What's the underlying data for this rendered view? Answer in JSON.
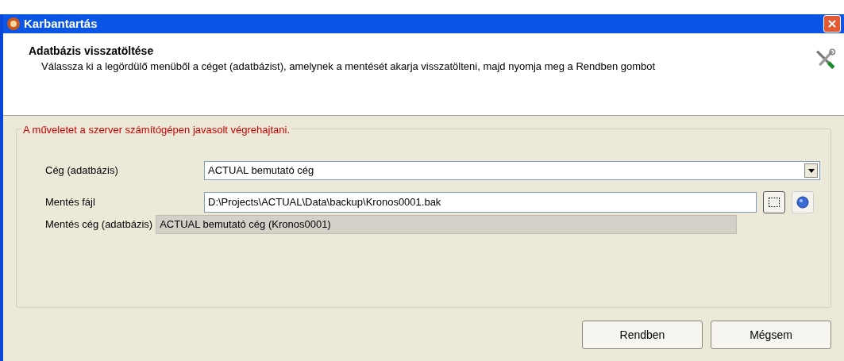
{
  "window": {
    "title": "Karbantartás"
  },
  "header": {
    "title": "Adatbázis visszatöltése",
    "description": "Válassza ki a legördülő menüből a céget (adatbázist), amelynek a mentését akarja visszatölteni, majd nyomja meg a Rendben gombot"
  },
  "group": {
    "title": "A műveletet a szerver számítógépen javasolt végrehajtani."
  },
  "fields": [
    {
      "kind": "dropdown",
      "label": "Cég (adatbázis)",
      "value": "ACTUAL bemutató cég"
    },
    {
      "kind": "file",
      "label": "Mentés fájl",
      "value": "D:\\Projects\\ACTUAL\\Data\\backup\\Kronos0001.bak"
    },
    {
      "kind": "readonly",
      "label": "Mentés cég (adatbázis)",
      "value": "ACTUAL bemutató cég (Kronos0001)"
    }
  ],
  "buttons": [
    "Rendben",
    "Mégsem"
  ]
}
